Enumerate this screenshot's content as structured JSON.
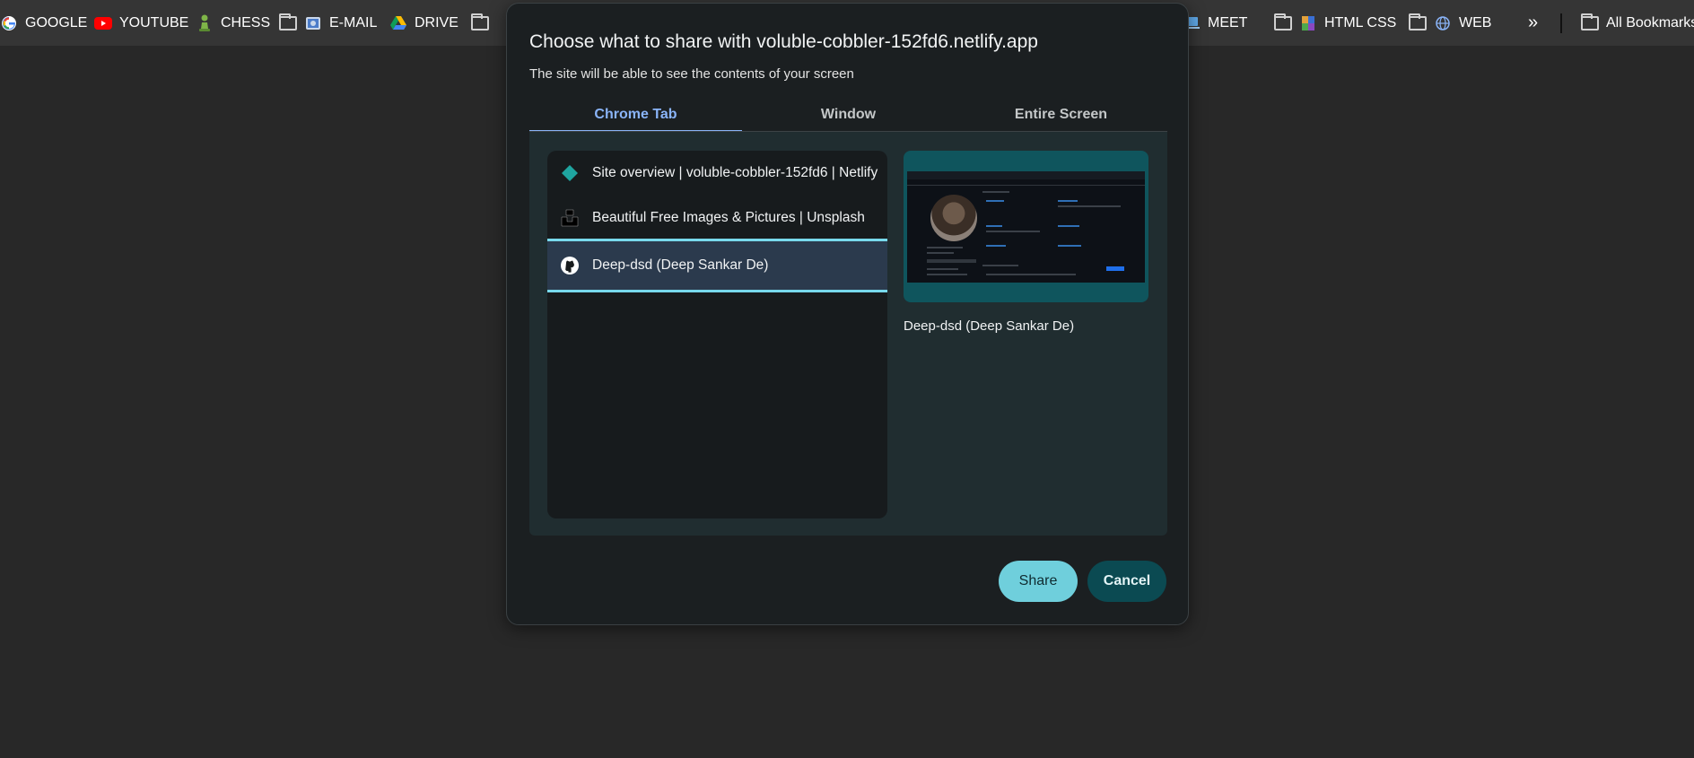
{
  "bookmarks": {
    "items": [
      {
        "label": "GOOGLE",
        "icon": "google-icon"
      },
      {
        "label": "YOUTUBE",
        "icon": "youtube-icon"
      },
      {
        "label": "CHESS",
        "icon": "chess-pawn-icon"
      },
      {
        "label": "E-MAIL",
        "icon": "folder-icon"
      },
      {
        "label": "DRIVE",
        "icon": "drive-icon"
      },
      {
        "label": "MEET",
        "icon": "folder-icon"
      },
      {
        "label": "HTML CSS",
        "icon": "folder-icon"
      },
      {
        "label": "WEB",
        "icon": "folder-icon"
      }
    ],
    "overflow_glyph": "»",
    "all_bookmarks_label": "All Bookmarks"
  },
  "dialog": {
    "title": "Choose what to share with voluble-cobbler-152fd6.netlify.app",
    "subtitle": "The site will be able to see the contents of your screen",
    "tabs": [
      {
        "label": "Chrome Tab",
        "active": true
      },
      {
        "label": "Window",
        "active": false
      },
      {
        "label": "Entire Screen",
        "active": false
      }
    ],
    "tab_list": [
      {
        "title": "Site overview | voluble-cobbler-152fd6 | Netlify",
        "icon": "netlify-icon",
        "selected": false
      },
      {
        "title": "Beautiful Free Images & Pictures | Unsplash",
        "icon": "unsplash-icon",
        "selected": false
      },
      {
        "title": "Deep-dsd (Deep Sankar De)",
        "icon": "github-icon",
        "selected": true
      }
    ],
    "preview_label": "Deep-dsd (Deep Sankar De)",
    "share_label": "Share",
    "cancel_label": "Cancel"
  },
  "colors": {
    "accent_tab": "#8ab4f8",
    "share_button": "#6fcfdc",
    "cancel_button": "#0b4a52",
    "selection_border": "#78d9ec"
  }
}
